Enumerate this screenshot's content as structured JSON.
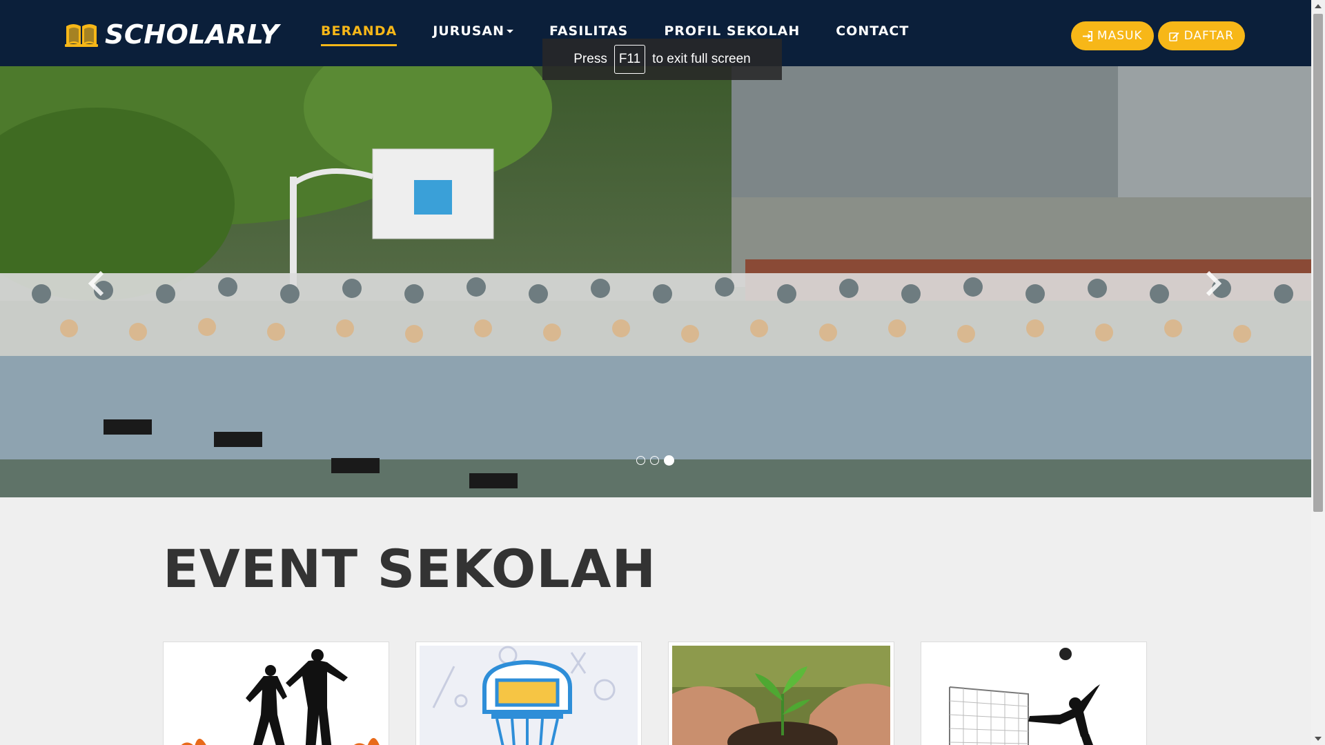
{
  "brand": {
    "name": "SCHOLARLY",
    "logo_icon": "open-book-icon"
  },
  "nav": {
    "items": [
      {
        "label": "BERANDA",
        "active": true
      },
      {
        "label": "JURUSAN",
        "dropdown": true
      },
      {
        "label": "FASILITAS"
      },
      {
        "label": "PROFIL SEKOLAH"
      },
      {
        "label": "CONTACT"
      }
    ]
  },
  "auth": {
    "login_label": "MASUK",
    "login_icon": "sign-in-icon",
    "register_label": "DAFTAR",
    "register_icon": "edit-icon"
  },
  "fullscreen_hint": {
    "before": "Press",
    "key": "F11",
    "after": "to exit full screen"
  },
  "carousel": {
    "slide_count": 3,
    "active_index": 2,
    "prev_icon": "chevron-left-icon",
    "next_icon": "chevron-right-icon"
  },
  "section": {
    "title": "EVENT SEKOLAH"
  },
  "cards": [
    {
      "image": "futsal-players-silhouette"
    },
    {
      "image": "basketball-hoop-illustration"
    },
    {
      "image": "hands-holding-seedling"
    },
    {
      "image": "volleyball-player-silhouette"
    }
  ],
  "colors": {
    "navbar": "#0b1f3a",
    "accent": "#f7b718",
    "background": "#efefef",
    "title": "#333333"
  }
}
